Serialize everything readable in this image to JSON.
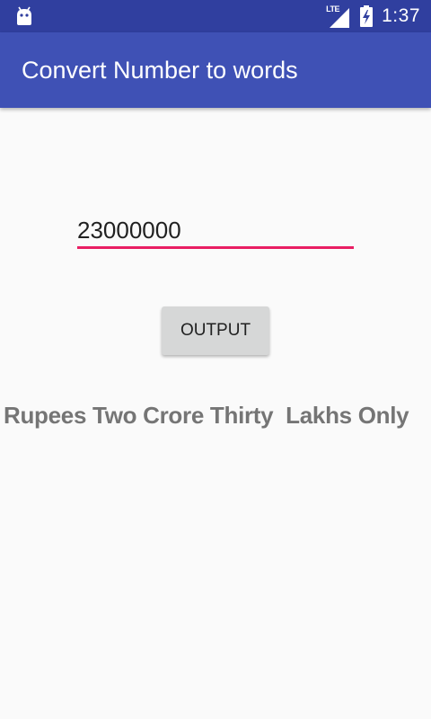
{
  "status_bar": {
    "network_label": "LTE",
    "time": "1:37",
    "icons": [
      "android-icon",
      "lte-signal-icon",
      "battery-charging-icon"
    ]
  },
  "app_bar": {
    "title": "Convert Number to words",
    "color": "#3f51b5"
  },
  "form": {
    "number_value": "23000000",
    "underline_color": "#e91e63"
  },
  "actions": {
    "output_label": "OUTPUT"
  },
  "result": {
    "text": "Rupees Two Crore Thirty  Lakhs Only"
  }
}
